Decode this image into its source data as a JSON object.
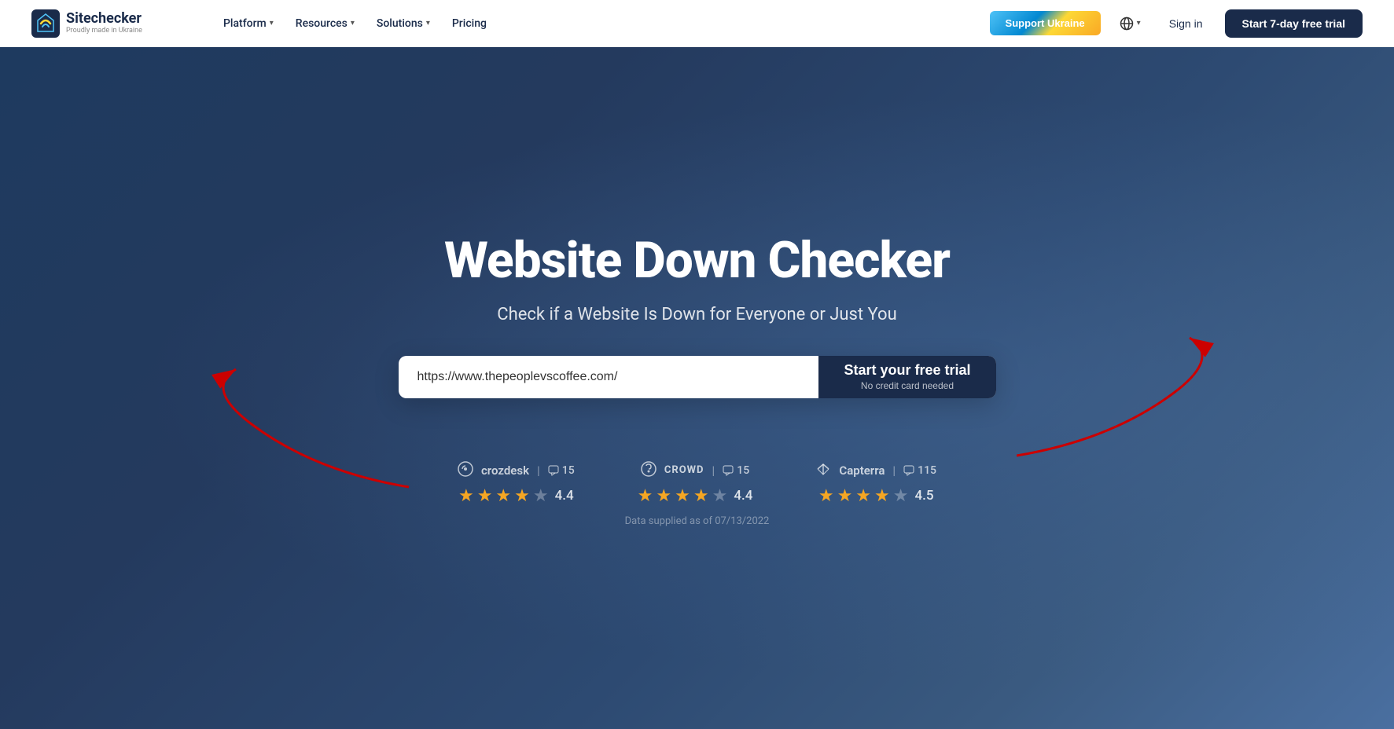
{
  "navbar": {
    "logo_name": "Sitechecker",
    "logo_tagline": "Proudly made in Ukraine",
    "nav_items": [
      {
        "label": "Platform",
        "has_dropdown": true
      },
      {
        "label": "Resources",
        "has_dropdown": true
      },
      {
        "label": "Solutions",
        "has_dropdown": true
      },
      {
        "label": "Pricing",
        "has_dropdown": false
      }
    ],
    "support_ukraine_label": "Support Ukraine",
    "globe_label": "",
    "sign_in_label": "Sign in",
    "trial_btn_label": "Start 7-day free trial"
  },
  "hero": {
    "title": "Website Down Checker",
    "subtitle": "Check if a Website Is Down for Everyone or Just You",
    "input_placeholder": "https://www.thepeoplevscoffee.com/",
    "cta_main": "Start your free trial",
    "cta_sub": "No credit card needed"
  },
  "ratings": [
    {
      "platform": "crozdesk",
      "platform_label": "crozdesk",
      "review_count": "15",
      "score": "4.4",
      "full_stars": 4,
      "half_star": true,
      "empty_stars": 1
    },
    {
      "platform": "crowd",
      "platform_label": "CROWD",
      "review_count": "15",
      "score": "4.4",
      "full_stars": 4,
      "half_star": true,
      "empty_stars": 1
    },
    {
      "platform": "capterra",
      "platform_label": "Capterra",
      "review_count": "115",
      "score": "4.5",
      "full_stars": 4,
      "half_star": true,
      "empty_stars": 1
    }
  ],
  "data_source_label": "Data supplied as of 07/13/2022"
}
